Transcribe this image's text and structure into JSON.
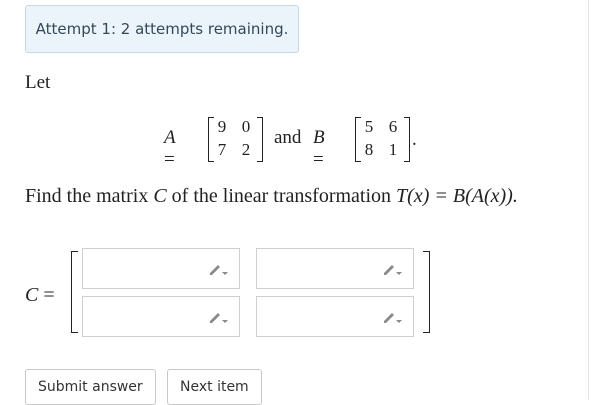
{
  "alert": {
    "text": "Attempt 1: 2 attempts remaining."
  },
  "problem": {
    "intro": "Let",
    "A_label": "A =",
    "and_text": "and",
    "B_label": "B =",
    "matrix_A": [
      [
        "9",
        "0"
      ],
      [
        "7",
        "2"
      ]
    ],
    "matrix_B": [
      [
        "5",
        "6"
      ],
      [
        "8",
        "1"
      ]
    ],
    "period": ".",
    "find_text_1": "Find the matrix ",
    "find_C": "C",
    "find_text_2": " of the linear transformation ",
    "find_formula": "T(x) = B(A(x)).",
    "answer_label": "C ="
  },
  "answer": {
    "cells": [
      "",
      "",
      "",
      ""
    ],
    "edit_icon": "pencil-icon"
  },
  "buttons": {
    "submit": "Submit answer",
    "next": "Next item"
  }
}
